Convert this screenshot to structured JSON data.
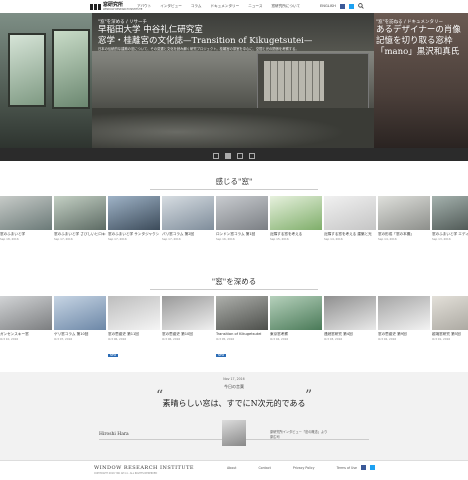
{
  "header": {
    "logo_title": "窓研究所",
    "logo_sub": "WINDOW RESEARCH INSTITUTE",
    "nav": [
      "アバウト",
      "インタビュー",
      "コラム",
      "ドキュメンタリー",
      "ニュース",
      "窓研究所について"
    ],
    "lang": "ENGLISH",
    "colors": {
      "facebook": "#3b5998",
      "twitter": "#1da1f2"
    }
  },
  "hero": {
    "category": "\"窓\"を深める / リサーチ",
    "title1": "早稲田大学 中谷礼仁研究室",
    "title2": "窓学・桂離宮の文化誌—Transition of Kikugetsutei—",
    "desc": "日本の伝統的な建築の窓について、その変遷と文化を読み解く研究プロジェクト。桂離宮の茶室を中心に、空間と光の関係を考察する。",
    "side_category": "\"窓\"を訪ねる / ドキュメンタリー",
    "side_title1": "あるデザイナーの肖像",
    "side_title2": "記憶を切り取る窓枠",
    "side_title3": "「mano」黒沢和真氏"
  },
  "section1": {
    "title": "感じる\"窓\"",
    "cards": [
      {
        "title": "窓のふまいと学",
        "meta": "Sep 18, 2016",
        "c1": "#6b7a78",
        "c2": "#c7cbc8"
      },
      {
        "title": "窓のふまいと学 さびしいヒロキの窓",
        "meta": "Sep 17, 2016",
        "c1": "#5d6b64",
        "c2": "#c4d0c4"
      },
      {
        "title": "窓のふまいと学 サンタジャクショの窓",
        "meta": "Sep 17, 2016",
        "c1": "#3c4b5a",
        "c2": "#9fb3c7"
      },
      {
        "title": "パリ窓コラム 第2回",
        "meta": "Sep 17, 2016",
        "c1": "#7f8d9b",
        "c2": "#d7dde2"
      },
      {
        "title": "ロンドン窓コラム 第1回",
        "meta": "Sep 16, 2016",
        "c1": "#7b7f84",
        "c2": "#c9ccd0"
      },
      {
        "title": "近隣する窓を考える",
        "meta": "Sep 15, 2016",
        "c1": "#7fae6a",
        "c2": "#e7f1de"
      },
      {
        "title": "近隣する窓を考える 建築と光",
        "meta": "Sep 14, 2016",
        "c1": "#c5c5c5",
        "c2": "#f1f1f1"
      },
      {
        "title": "窓の形成「窓の本棚」",
        "meta": "Sep 14, 2016",
        "c1": "#8d8f8b",
        "c2": "#dfe0dc"
      },
      {
        "title": "窓のふまいと学 エディットとショルの窓",
        "meta": "Sep 13, 2016",
        "c1": "#47504d",
        "c2": "#a5b2ae"
      },
      {
        "title": "窓のふまいと学 アマンダの窓",
        "meta": "Sep 12, 2016",
        "c1": "#8a4b3c",
        "c2": "#d4a596"
      }
    ]
  },
  "section2": {
    "title": "\"窓\"を深める",
    "cards": [
      {
        "title": "ガンセンスキー窓",
        "meta": "Oct 10, 2016",
        "c1": "#7c7e80",
        "c2": "#d2d4d6",
        "tag": ""
      },
      {
        "title": "ゲリ窓コラム 第10回",
        "meta": "Oct 07, 2016",
        "c1": "#6c87a7",
        "c2": "#c7d5e4",
        "tag": ""
      },
      {
        "title": "窓の思惑史 第11回",
        "meta": "Oct 06, 2016",
        "c1": "#f5f5f5",
        "c2": "#bdbdbd",
        "tag": "NEW"
      },
      {
        "title": "窓の思惑史 第10回",
        "meta": "Oct 06, 2016",
        "c1": "#f0f0f0",
        "c2": "#999999",
        "tag": ""
      },
      {
        "title": "Transition of Kikugetsutei",
        "meta": "Oct 05, 2016",
        "c1": "#4d4f4b",
        "c2": "#aeb0ac",
        "tag": "NEW"
      },
      {
        "title": "東京窓考察",
        "meta": "Oct 04, 2016",
        "c1": "#4a7a58",
        "c2": "#b6d1bc",
        "tag": ""
      },
      {
        "title": "連続窓研究 第4回",
        "meta": "Oct 03, 2016",
        "c1": "#e9e9e9",
        "c2": "#8f8f8f",
        "tag": ""
      },
      {
        "title": "窓の思惑史 第9回",
        "meta": "Oct 02, 2016",
        "c1": "#f3f3f3",
        "c2": "#a5a5a5",
        "tag": ""
      },
      {
        "title": "越境窓研究 第5回",
        "meta": "Oct 01, 2016",
        "c1": "#a6a39c",
        "c2": "#e3e0d9",
        "tag": ""
      },
      {
        "title": "オンタキシー 窓越境",
        "meta": "Sep 30, 2016",
        "c1": "#3f4c59",
        "c2": "#9bb0c2",
        "tag": ""
      }
    ]
  },
  "quote": {
    "date": "Nov 17, 2016",
    "heading": "今日の言葉",
    "text": "素晴らしい窓は、すでにN次元的である",
    "author": "Hiroshi Hara",
    "source1": "原研究所インタビュー「窓の概念」より",
    "source2": "原広司"
  },
  "footer": {
    "brand": "WINDOW RESEARCH INSTITUTE",
    "copyright": "COPYRIGHT 2016 YKK AP Inc. ALL RIGHTS RESERVED",
    "links": [
      "About",
      "Contact",
      "Privacy Policy",
      "Terms of Use"
    ]
  }
}
